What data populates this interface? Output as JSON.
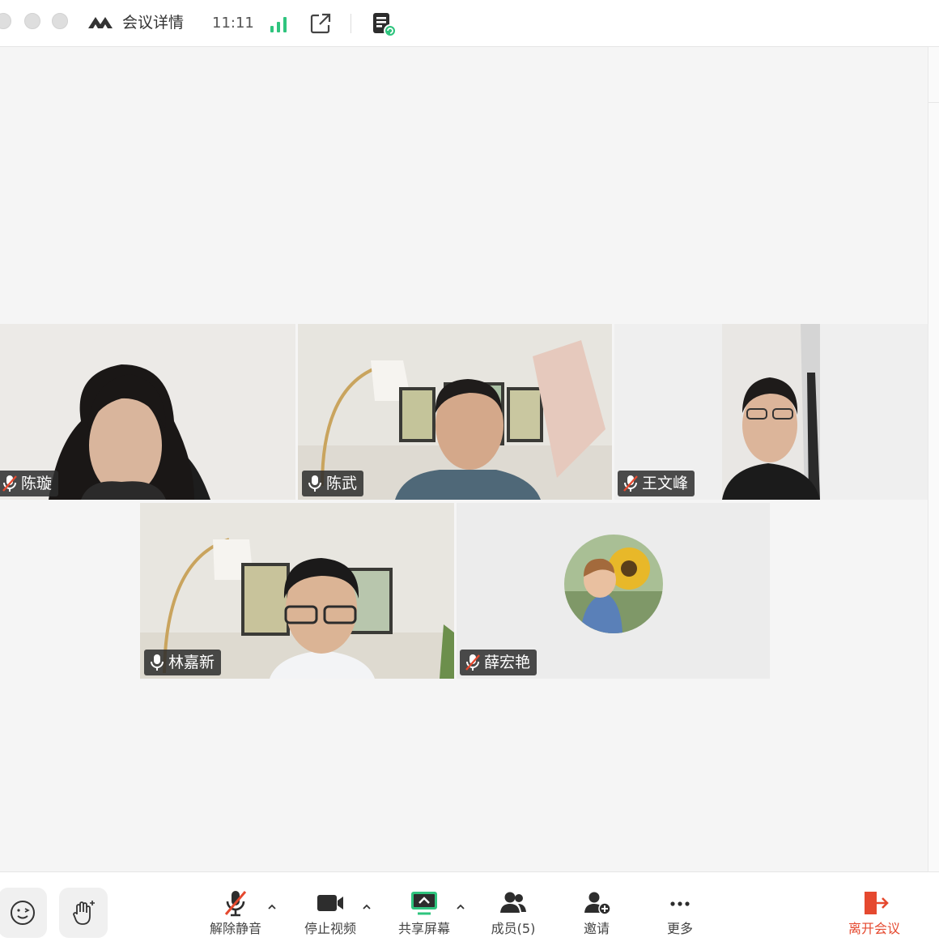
{
  "titlebar": {
    "title": "会议详情",
    "clock": "11:11",
    "icons": [
      "meeting-logo-icon",
      "signal-icon",
      "popout-icon",
      "document-icon"
    ]
  },
  "participants": [
    {
      "name": "陈璇",
      "mic": "muted"
    },
    {
      "name": "陈武",
      "mic": "on",
      "speaking": true
    },
    {
      "name": "王文峰",
      "mic": "muted"
    },
    {
      "name": "林嘉新",
      "mic": "on"
    },
    {
      "name": "薛宏艳",
      "mic": "muted",
      "video": "off"
    }
  ],
  "toolbar": {
    "unmute": "解除静音",
    "stop_video": "停止视频",
    "share_screen": "共享屏幕",
    "members": "成员(5)",
    "invite": "邀请",
    "more": "更多",
    "leave": "离开会议"
  },
  "colors": {
    "accent_green": "#2fc47e",
    "leave_red": "#e5492f"
  }
}
